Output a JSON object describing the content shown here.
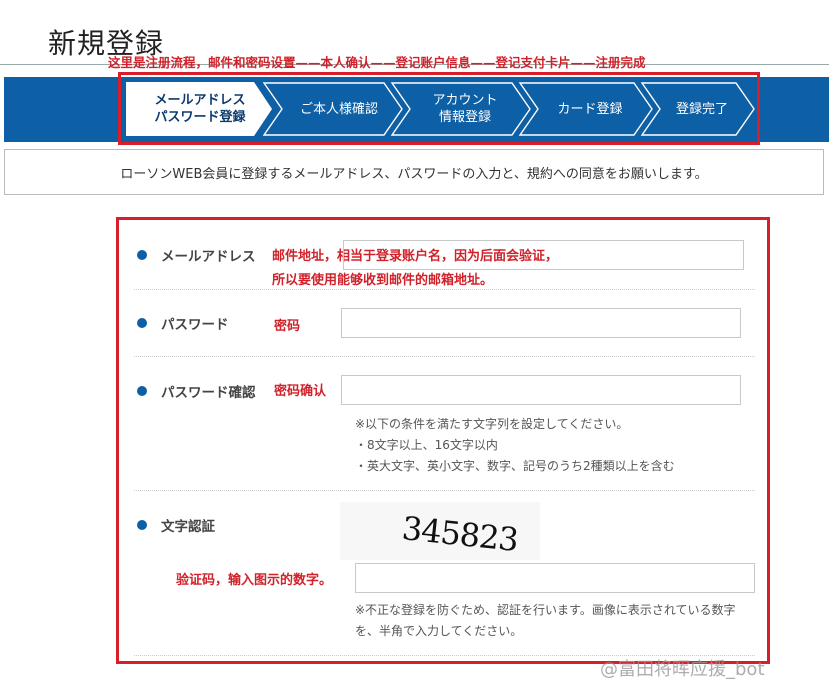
{
  "page": {
    "title": "新規登録",
    "flow_annotation": "这里是注册流程，邮件和密码设置——本人确认——登记账户信息——登记支付卡片——注册完成"
  },
  "steps": [
    {
      "label_line1": "メールアドレス",
      "label_line2": "パスワード登録",
      "active": true
    },
    {
      "label_line1": "ご本人様確認",
      "label_line2": "",
      "active": false
    },
    {
      "label_line1": "アカウント",
      "label_line2": "情報登録",
      "active": false
    },
    {
      "label_line1": "カード登録",
      "label_line2": "",
      "active": false
    },
    {
      "label_line1": "登録完了",
      "label_line2": "",
      "active": false
    }
  ],
  "intro": "ローソンWEB会員に登録するメールアドレス、パスワードの入力と、規約への同意をお願いします。",
  "form": {
    "email": {
      "label": "メールアドレス",
      "annotation_line1": "邮件地址，相当于登录账户名，因为后面会验证，",
      "annotation_line2": "所以要使用能够收到邮件的邮箱地址。",
      "value": ""
    },
    "password": {
      "label": "パスワード",
      "annotation": "密码",
      "value": ""
    },
    "password_confirm": {
      "label": "パスワード確認",
      "annotation": "密码确认",
      "value": "",
      "notes": [
        "※以下の条件を満たす文字列を設定してください。",
        "・8文字以上、16文字以内",
        "・英大文字、英小文字、数字、記号のうち2種類以上を含む"
      ]
    },
    "captcha": {
      "label": "文字認証",
      "code": "345823",
      "annotation": "验证码，输入图示的数字。",
      "value": "",
      "note_line1": "※不正な登録を防ぐため、認証を行います。画像に表示されている数字",
      "note_line2": "を、半角で入力してください。"
    }
  },
  "watermark": "@富田将晖应援_bot",
  "colors": {
    "step_bar": "#0d5fa6",
    "annotation_red": "#d0222a",
    "bullet": "#0d5fa6"
  }
}
